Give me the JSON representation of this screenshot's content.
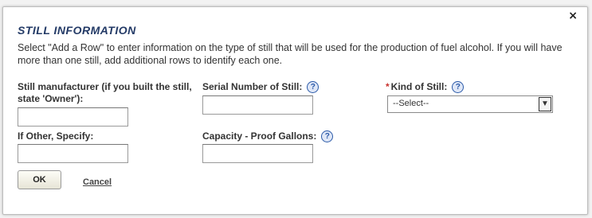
{
  "dialog": {
    "title": "STILL INFORMATION",
    "close_glyph": "×",
    "instructions": "Select \"Add a Row\" to enter information on the type of still that will be used for the production of fuel alcohol. If you will have more than one still, add additional rows to identify each one."
  },
  "fields": {
    "manufacturer": {
      "label": "Still manufacturer (if you built the still, state 'Owner'):",
      "value": ""
    },
    "serial": {
      "label": "Serial Number of Still:",
      "value": ""
    },
    "kind": {
      "required_marker": "*",
      "label": "Kind of Still:",
      "selected": "--Select--"
    },
    "other": {
      "label": "If Other, Specify:",
      "value": ""
    },
    "capacity": {
      "label": "Capacity - Proof Gallons:",
      "value": ""
    }
  },
  "help_glyph": "?",
  "buttons": {
    "ok": "OK",
    "cancel": "Cancel"
  },
  "icons": {
    "close": "close-icon",
    "help": "help-icon",
    "dropdown": "chevron-down-icon"
  }
}
